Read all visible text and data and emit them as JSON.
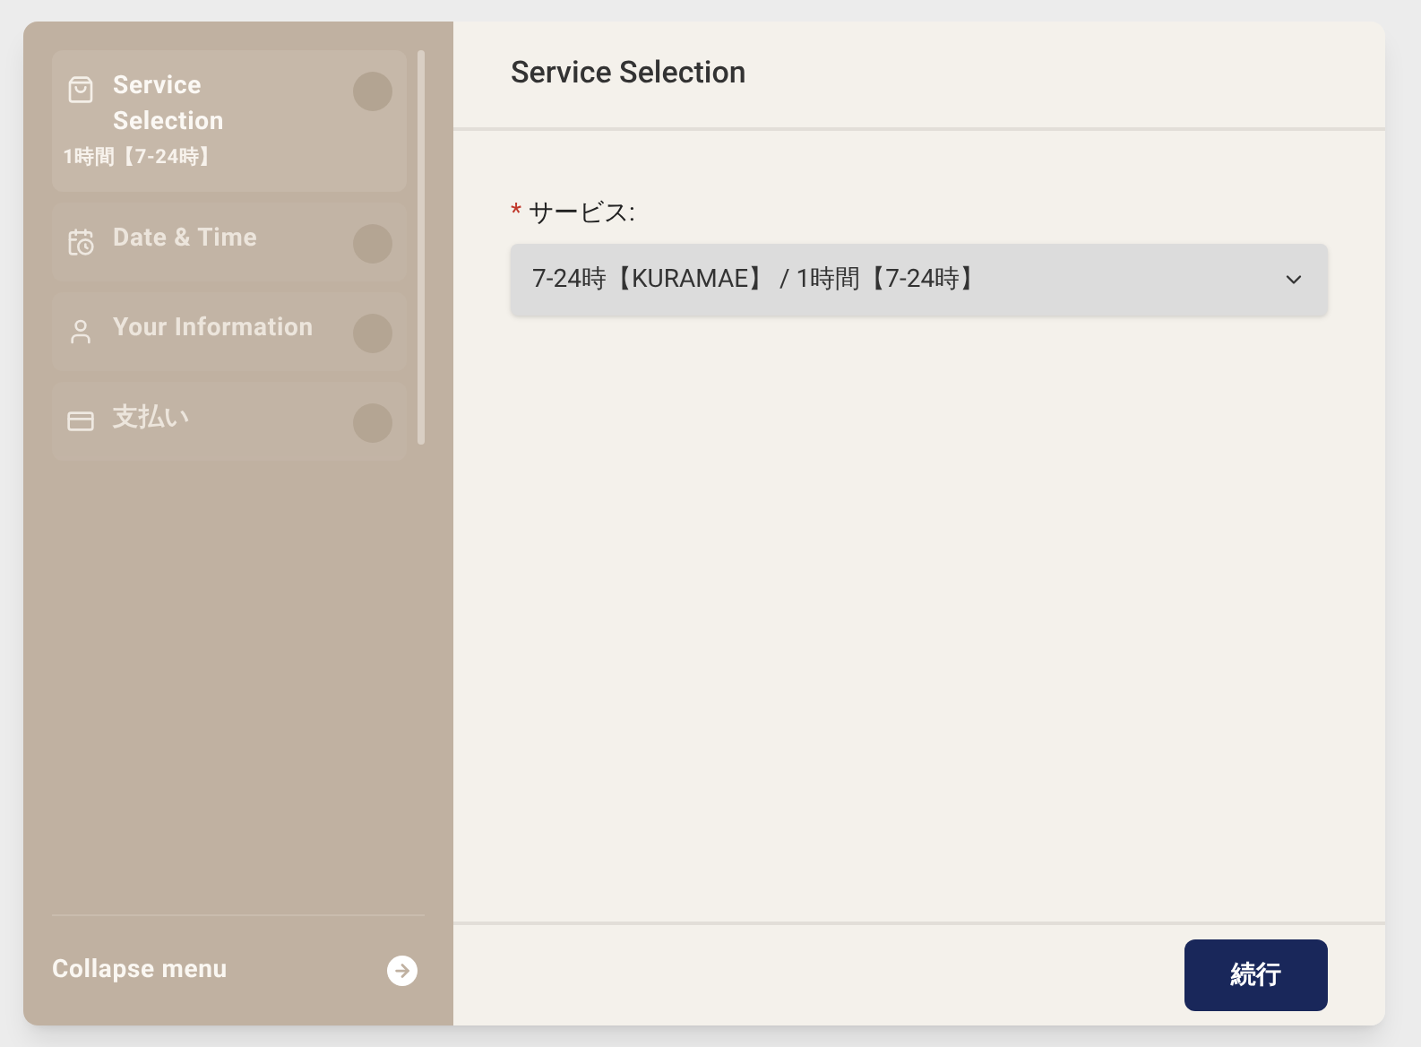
{
  "sidebar": {
    "steps": [
      {
        "kind": "cart",
        "label": "Service Selection",
        "subtitle": "1時間【7-24時】",
        "selected": true
      },
      {
        "kind": "calendar",
        "label": "Date & Time",
        "selected": false
      },
      {
        "kind": "person",
        "label": "Your Information",
        "selected": false
      },
      {
        "kind": "card",
        "label": "支払い",
        "selected": false
      }
    ],
    "collapse_label": "Collapse menu"
  },
  "main": {
    "title": "Service Selection",
    "field": {
      "required_mark": "*",
      "label": "サービス:",
      "value": "7-24時【KURAMAE】 / 1時間【7-24時】"
    },
    "continue_button": "続行"
  }
}
